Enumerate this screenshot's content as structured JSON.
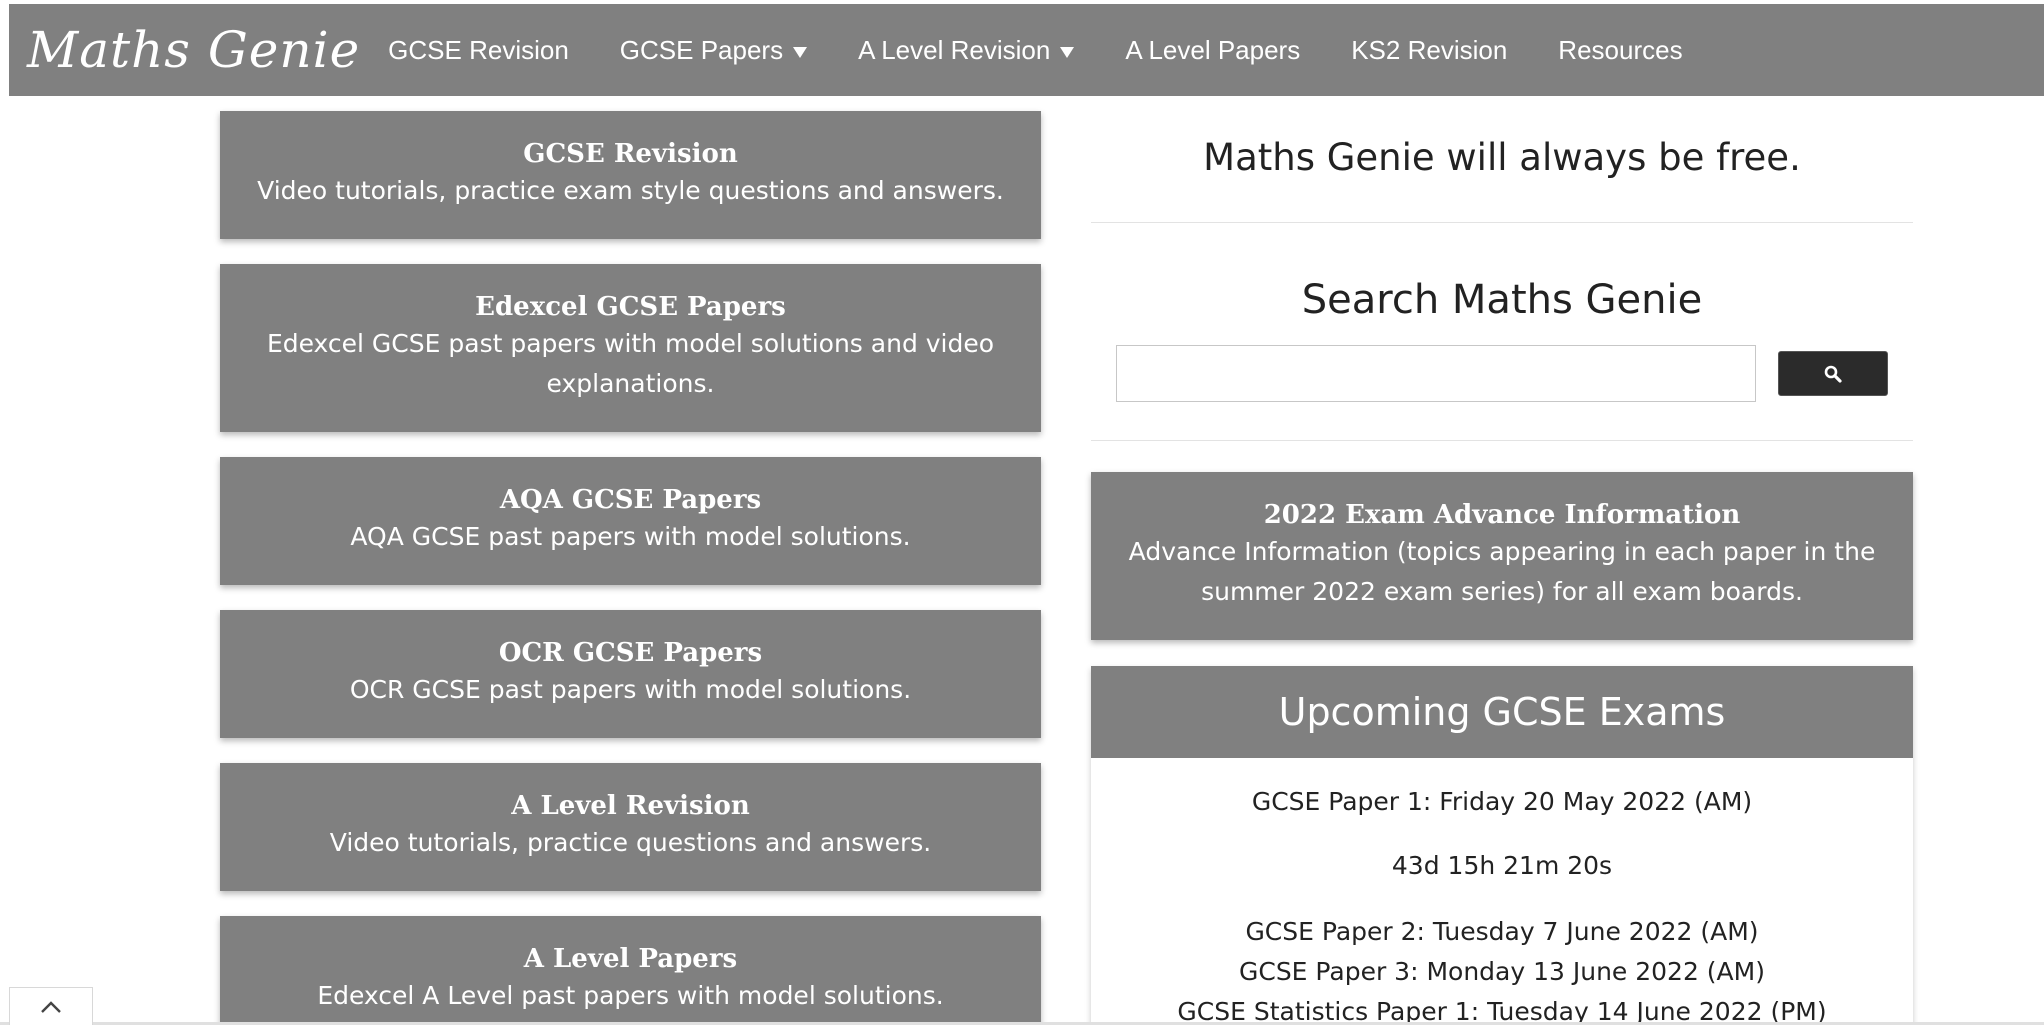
{
  "header": {
    "logo": "Maths Genie",
    "nav": [
      {
        "label": "GCSE Revision",
        "dropdown": false
      },
      {
        "label": "GCSE Papers",
        "dropdown": true
      },
      {
        "label": "A Level Revision",
        "dropdown": true
      },
      {
        "label": "A Level Papers",
        "dropdown": false
      },
      {
        "label": "KS2 Revision",
        "dropdown": false
      },
      {
        "label": "Resources",
        "dropdown": false
      }
    ]
  },
  "left_cards": [
    {
      "title": "GCSE Revision",
      "desc": "Video tutorials, practice exam style questions and answers."
    },
    {
      "title": "Edexcel GCSE Papers",
      "desc": "Edexcel GCSE past papers with model solutions and video explanations."
    },
    {
      "title": "AQA GCSE Papers",
      "desc": "AQA GCSE past papers with model solutions."
    },
    {
      "title": "OCR GCSE Papers",
      "desc": "OCR GCSE past papers with model solutions."
    },
    {
      "title": "A Level Revision",
      "desc": "Video tutorials, practice questions and answers."
    },
    {
      "title": "A Level Papers",
      "desc": "Edexcel A Level past papers with model solutions."
    }
  ],
  "right": {
    "tagline": "Maths Genie will always be free.",
    "search": {
      "heading": "Search Maths Genie",
      "value": "",
      "placeholder": "",
      "button_icon": "search-icon"
    },
    "advance_info": {
      "title": "2022 Exam Advance Information",
      "desc": "Advance Information (topics appearing in each paper in the summer 2022 exam series) for all exam boards."
    },
    "upcoming": {
      "heading": "Upcoming GCSE Exams",
      "first_exam": "GCSE Paper 1: Friday 20 May 2022 (AM)",
      "countdown": "43d 15h 21m 20s",
      "other_exams": [
        "GCSE Paper 2: Tuesday 7 June 2022 (AM)",
        "GCSE Paper 3: Monday 13 June 2022 (AM)",
        "GCSE Statistics Paper 1: Tuesday 14 June 2022 (PM)"
      ]
    }
  },
  "colors": {
    "nav_bg": "#808080",
    "card_bg": "#808080",
    "button_bg": "#2b2b2b",
    "text": "#222222"
  },
  "icons": {
    "scroll_top": "chevron-up-icon",
    "dropdown": "caret-down-icon"
  }
}
